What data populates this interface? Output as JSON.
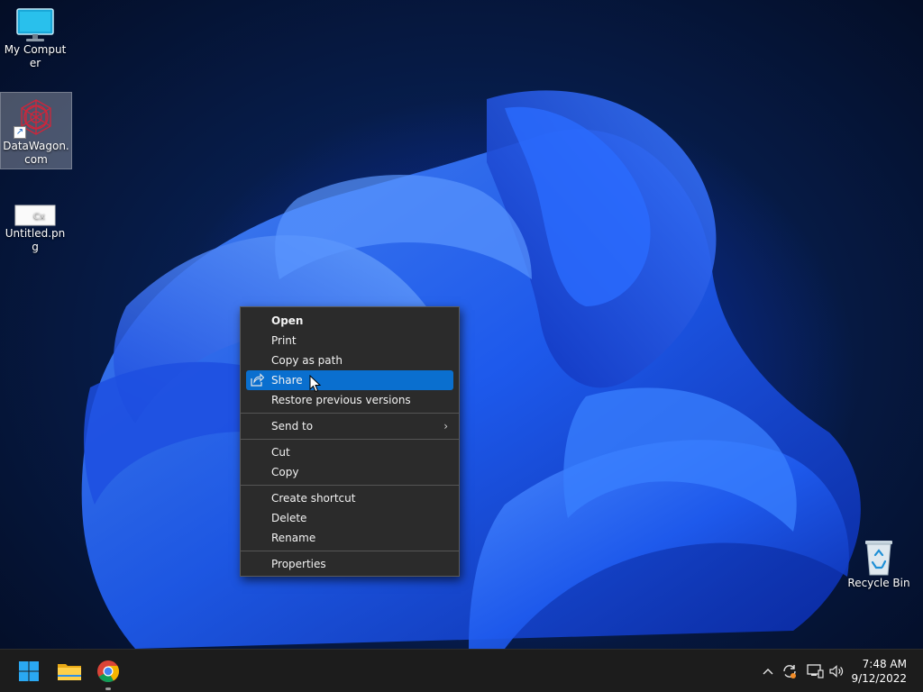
{
  "desktop": {
    "icons": [
      {
        "label": "My Computer"
      },
      {
        "label": "DataWagon.com"
      },
      {
        "label": "Untitled.png"
      },
      {
        "label": "Recycle Bin"
      }
    ]
  },
  "context_menu": {
    "items": [
      {
        "label": "Open",
        "icon": null
      },
      {
        "label": "Print",
        "icon": null
      },
      {
        "label": "Copy as path",
        "icon": null
      },
      {
        "label": "Share",
        "icon": "share-icon"
      },
      {
        "label": "Restore previous versions",
        "icon": null
      },
      {
        "label": "Send to",
        "icon": null,
        "submenu": true
      },
      {
        "label": "Cut",
        "icon": null
      },
      {
        "label": "Copy",
        "icon": null
      },
      {
        "label": "Create shortcut",
        "icon": null
      },
      {
        "label": "Delete",
        "icon": null
      },
      {
        "label": "Rename",
        "icon": null
      },
      {
        "label": "Properties",
        "icon": null
      }
    ],
    "highlighted": "Share"
  },
  "taskbar": {
    "apps": [
      "start-icon",
      "file-explorer-icon",
      "chrome-icon"
    ],
    "tray": [
      "chevron-up-icon",
      "sync-icon",
      "network-icon",
      "volume-icon"
    ],
    "clock": {
      "time": "7:48 AM",
      "date": "9/12/2022"
    }
  },
  "colors": {
    "menu_bg": "#2b2b2b",
    "menu_highlight": "#0a6fcf",
    "taskbar_bg": "#1c1c1c",
    "wallpaper_accent": "#0a3bbd"
  }
}
